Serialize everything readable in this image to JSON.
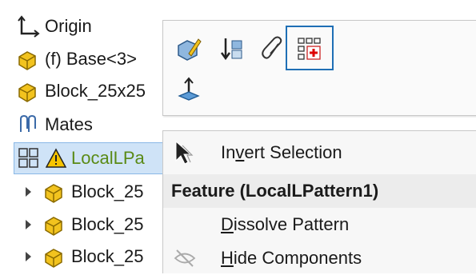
{
  "tree": {
    "items": [
      {
        "label": "Origin",
        "icon": "origin-axes-icon"
      },
      {
        "label": "(f) Base<3>",
        "icon": "part-icon"
      },
      {
        "label": "Block_25x25",
        "icon": "part-icon"
      },
      {
        "label": "Mates",
        "icon": "mates-paperclip-icon"
      },
      {
        "label": "LocalLPa",
        "icon": "pattern-icon",
        "warning_icon": "warning-icon",
        "selected": true
      },
      {
        "label": "Block_25",
        "icon": "part-icon",
        "expandable": true
      },
      {
        "label": "Block_25",
        "icon": "part-icon",
        "expandable": true
      },
      {
        "label": "Block_25",
        "icon": "part-icon",
        "expandable": true
      }
    ]
  },
  "toolbar": {
    "tools": [
      {
        "icon": "edit-part-icon"
      },
      {
        "icon": "rollback-icon"
      },
      {
        "icon": "attach-paperclip-icon"
      },
      {
        "icon": "add-to-pattern-icon",
        "active": true
      },
      {
        "icon": "insert-direction-icon"
      }
    ]
  },
  "menu": {
    "invert_selection": {
      "pre": "In",
      "ul": "v",
      "post": "ert Selection",
      "icon": "cursor-arrow-icon"
    },
    "header": "Feature (LocalLPattern1)",
    "dissolve_pattern": {
      "ul": "D",
      "post": "issolve Pattern"
    },
    "hide_components": {
      "ul": "H",
      "post": "ide Components",
      "icon": "hide-eye-icon"
    }
  },
  "colors": {
    "selection_bg": "#cfe3f7",
    "warning_text": "#5a8a16",
    "active_tool_border": "#1f6fb5",
    "part_yellow": "#f2c31e"
  }
}
